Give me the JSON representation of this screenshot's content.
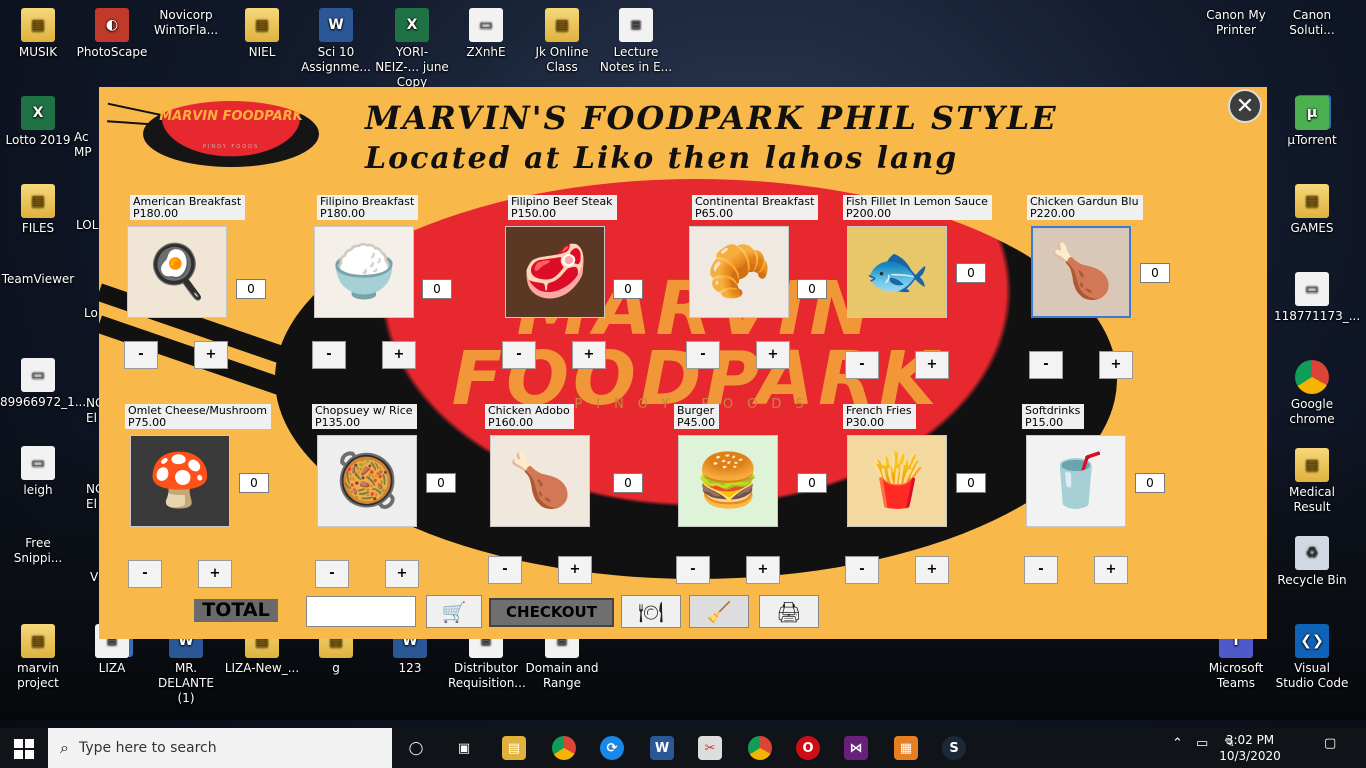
{
  "desktop": {
    "left_icons": [
      {
        "name": "MUSIK",
        "type": "folder"
      },
      {
        "name": "PhotoScape",
        "type": "app"
      },
      {
        "name": "Novicorp WinToFla...",
        "type": "app"
      },
      {
        "name": "NIEL",
        "type": "folder"
      },
      {
        "name": "Sci 10 Assignme...",
        "type": "word"
      },
      {
        "name": "YORI-NEIZ-... june Copy",
        "type": "excel"
      },
      {
        "name": "ZXnhE",
        "type": "doc"
      },
      {
        "name": "Jk Online Class",
        "type": "folder"
      },
      {
        "name": "Lecture Notes in E...",
        "type": "doc"
      }
    ],
    "col1_icons": [
      {
        "name": "Lotto 2019",
        "type": "excel"
      },
      {
        "name": "FILES",
        "type": "folder"
      },
      {
        "name": "TeamViewer",
        "type": "app"
      },
      {
        "name": "89966972_1...",
        "type": "doc"
      },
      {
        "name": "leigh",
        "type": "doc"
      },
      {
        "name": "Free Snippi...",
        "type": "app"
      },
      {
        "name": "marvin project",
        "type": "folder"
      }
    ],
    "col2_partial": [
      "Ac MP",
      "LOL",
      "Lo",
      "NC El",
      "NC El",
      "V"
    ],
    "bottom_icons": [
      {
        "name": "LIZA",
        "type": "doc"
      },
      {
        "name": "MR. DELANTE (1)",
        "type": "word"
      },
      {
        "name": "LIZA-New_...",
        "type": "folder"
      },
      {
        "name": "g",
        "type": "folder"
      },
      {
        "name": "123",
        "type": "word"
      },
      {
        "name": "Distributor Requisition...",
        "type": "doc"
      },
      {
        "name": "Domain and Range",
        "type": "doc"
      }
    ],
    "right_icons": [
      {
        "name": "Canon My Printer",
        "type": "app"
      },
      {
        "name": "Canon Soluti...",
        "type": "app"
      },
      {
        "name": "µTorrent",
        "type": "green"
      },
      {
        "name": "GAMES",
        "type": "folder"
      },
      {
        "name": "118771173_...",
        "type": "doc"
      },
      {
        "name": "Google chrome",
        "type": "chrome"
      },
      {
        "name": "Medical Result",
        "type": "folder"
      },
      {
        "name": "Recycle Bin",
        "type": "bin"
      },
      {
        "name": "Microsoft Teams",
        "type": "teams"
      },
      {
        "name": "Visual Studio Code",
        "type": "vs"
      }
    ]
  },
  "app": {
    "logo_text": "MARVIN FOODPARK",
    "logo_sub": "PINOY FOODS",
    "bg_big_text": "MARVIN FOODPARK",
    "bg_sub_text": "PINOY FOODS",
    "title": "MARVIN'S FOODPARK PHIL STYLE",
    "subtitle": "Located at Liko then lahos lang",
    "close_symbol": "✕",
    "items": [
      {
        "name": "American Breakfast",
        "price": "P180.00",
        "qty": "0",
        "emoji": "🍳"
      },
      {
        "name": "Filipino Breakfast",
        "price": "P180.00",
        "qty": "0",
        "emoji": "🍚"
      },
      {
        "name": "Filipino Beef Steak",
        "price": "P150.00",
        "qty": "0",
        "emoji": "🥩"
      },
      {
        "name": "Continental Breakfast",
        "price": "P65.00",
        "qty": "0",
        "emoji": "🥐"
      },
      {
        "name": "Fish Fillet In Lemon Sauce",
        "price": "P200.00",
        "qty": "0",
        "emoji": "🐟"
      },
      {
        "name": "Chicken Gardun Blu",
        "price": "P220.00",
        "qty": "0",
        "emoji": "🍗"
      },
      {
        "name": "Omlet Cheese/Mushroom",
        "price": "P75.00",
        "qty": "0",
        "emoji": "🍄"
      },
      {
        "name": "Chopsuey w/ Rice",
        "price": "P135.00",
        "qty": "0",
        "emoji": "🥘"
      },
      {
        "name": "Chicken Adobo",
        "price": "P160.00",
        "qty": "0",
        "emoji": "🍗"
      },
      {
        "name": "Burger",
        "price": "P45.00",
        "qty": "0",
        "emoji": "🍔"
      },
      {
        "name": "French Fries",
        "price": "P30.00",
        "qty": "0",
        "emoji": "🍟"
      },
      {
        "name": "Softdrinks",
        "price": "P15.00",
        "qty": "0",
        "emoji": "🥤"
      }
    ],
    "minus_label": "-",
    "plus_label": "+",
    "total_label": "TOTAL",
    "total_value": "",
    "checkout_label": "CHECKOUT",
    "icons": {
      "cart": "🛒",
      "serve": "🍽",
      "clear": "🧹",
      "print": "🖨"
    }
  },
  "taskbar": {
    "search_placeholder": "Type here to search",
    "time": "3:02 PM",
    "date": "10/3/2020"
  }
}
